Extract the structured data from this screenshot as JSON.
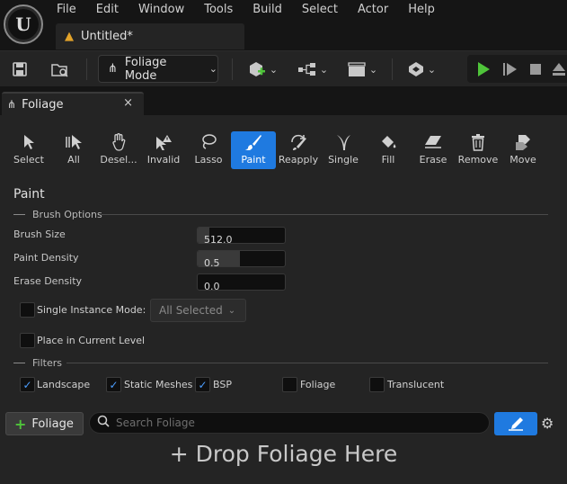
{
  "menu": [
    "File",
    "Edit",
    "Window",
    "Tools",
    "Build",
    "Select",
    "Actor",
    "Help"
  ],
  "document_tab": {
    "title": "Untitled*"
  },
  "toolbar": {
    "mode_label": "Foliage Mode"
  },
  "panel_tab": {
    "title": "Foliage",
    "close": "×"
  },
  "tools": [
    {
      "label": "Select",
      "icon": "select-arrow-icon",
      "active": false
    },
    {
      "label": "All",
      "icon": "select-all-icon",
      "active": false
    },
    {
      "label": "Deselect",
      "display": "Desel...",
      "icon": "deselect-hand-icon",
      "active": false
    },
    {
      "label": "Invalid",
      "icon": "invalid-warning-icon",
      "active": false
    },
    {
      "label": "Lasso",
      "icon": "lasso-icon",
      "active": false
    },
    {
      "label": "Paint",
      "icon": "paintbrush-icon",
      "active": true
    },
    {
      "label": "Reapply",
      "icon": "reapply-icon",
      "active": false
    },
    {
      "label": "Single",
      "icon": "single-grass-icon",
      "active": false
    },
    {
      "label": "Fill",
      "icon": "fill-bucket-icon",
      "active": false
    },
    {
      "label": "Erase",
      "icon": "eraser-icon",
      "active": false
    },
    {
      "label": "Remove",
      "icon": "trash-icon",
      "active": false
    },
    {
      "label": "Move",
      "icon": "move-icon",
      "active": false
    }
  ],
  "paint": {
    "title": "Paint",
    "brush_options": {
      "header": "Brush Options",
      "brush_size": {
        "label": "Brush Size",
        "value": "512.0",
        "fill_fraction": 0.13
      },
      "paint_density": {
        "label": "Paint Density",
        "value": "0.5",
        "fill_fraction": 0.48
      },
      "erase_density": {
        "label": "Erase Density",
        "value": "0.0",
        "fill_fraction": 0.0
      }
    },
    "single_instance_mode": {
      "label": "Single Instance Mode:",
      "checked": false,
      "dropdown_value": "All Selected"
    },
    "place_in_current_level": {
      "label": "Place in Current Level",
      "checked": false
    },
    "filters": {
      "header": "Filters",
      "items": [
        {
          "label": "Landscape",
          "checked": true
        },
        {
          "label": "Static Meshes",
          "checked": true
        },
        {
          "label": "BSP",
          "checked": true
        },
        {
          "label": "Foliage",
          "checked": false
        },
        {
          "label": "Translucent",
          "checked": false
        }
      ]
    }
  },
  "bottom": {
    "add_button": "Foliage",
    "search_placeholder": "Search Foliage",
    "drop_text": "+ Drop Foliage Here"
  },
  "colors": {
    "accent": "#1f7ae0",
    "check": "#4c9eff",
    "add_plus": "#4fc43a",
    "warning": "#e3a32a"
  }
}
